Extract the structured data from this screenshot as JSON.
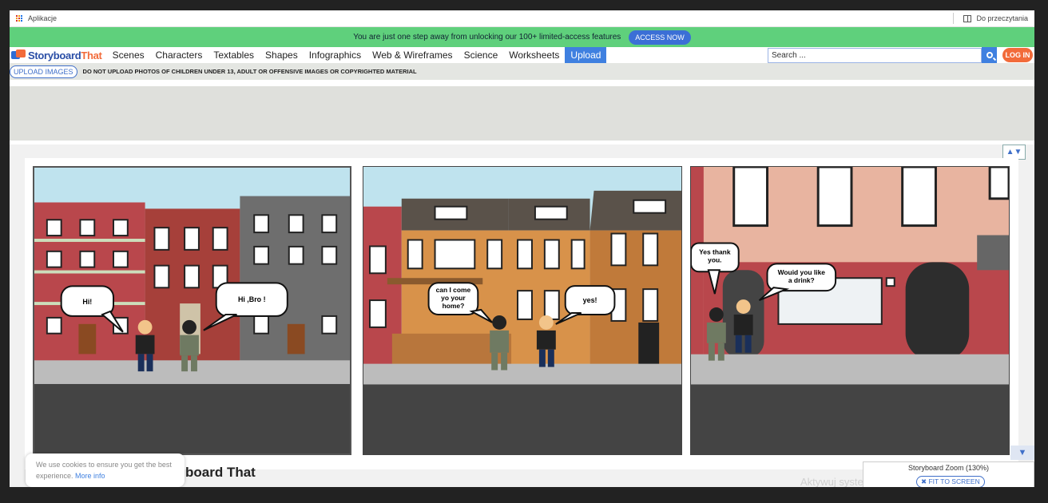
{
  "bookmarks": {
    "apps_label": "Aplikacje",
    "reading_list_label": "Do przeczytania"
  },
  "promo": {
    "text": "You are just one step away from unlocking our 100+ limited-access features",
    "button": "ACCESS NOW",
    "color": "#5fd07c"
  },
  "nav": {
    "logo_main": "Storyboard",
    "logo_accent": "That",
    "items": [
      "Scenes",
      "Characters",
      "Textables",
      "Shapes",
      "Infographics",
      "Web & Wireframes",
      "Science",
      "Worksheets",
      "Upload"
    ],
    "search_placeholder": "Search ...",
    "login": "LOG IN"
  },
  "upload_bar": {
    "button": "UPLOAD IMAGES",
    "warning": "DO NOT UPLOAD PHOTOS OF CHILDREN UNDER 13, ADULT OR OFFENSIVE IMAGES OR COPYRIGHTED MATERIAL"
  },
  "storyboard": {
    "cells": [
      {
        "bubbles": [
          "Hi!",
          "Hi ,Bro !"
        ]
      },
      {
        "bubbles": [
          "can I come yo your home?",
          "yes!"
        ]
      },
      {
        "bubbles": [
          "Yes thank you.",
          "Wouid you like a drink?"
        ]
      }
    ],
    "scroll_up": "▲▼",
    "scroll_down": "▼"
  },
  "cookie": {
    "text": "We use cookies to ensure you get the best experience.",
    "link": "More info"
  },
  "board_title_fragment": "board That",
  "zoom": {
    "label": "Storyboard Zoom (130%)",
    "fit_button": "FIT TO SCREEN"
  },
  "watermark": "Aktywuj system Window"
}
